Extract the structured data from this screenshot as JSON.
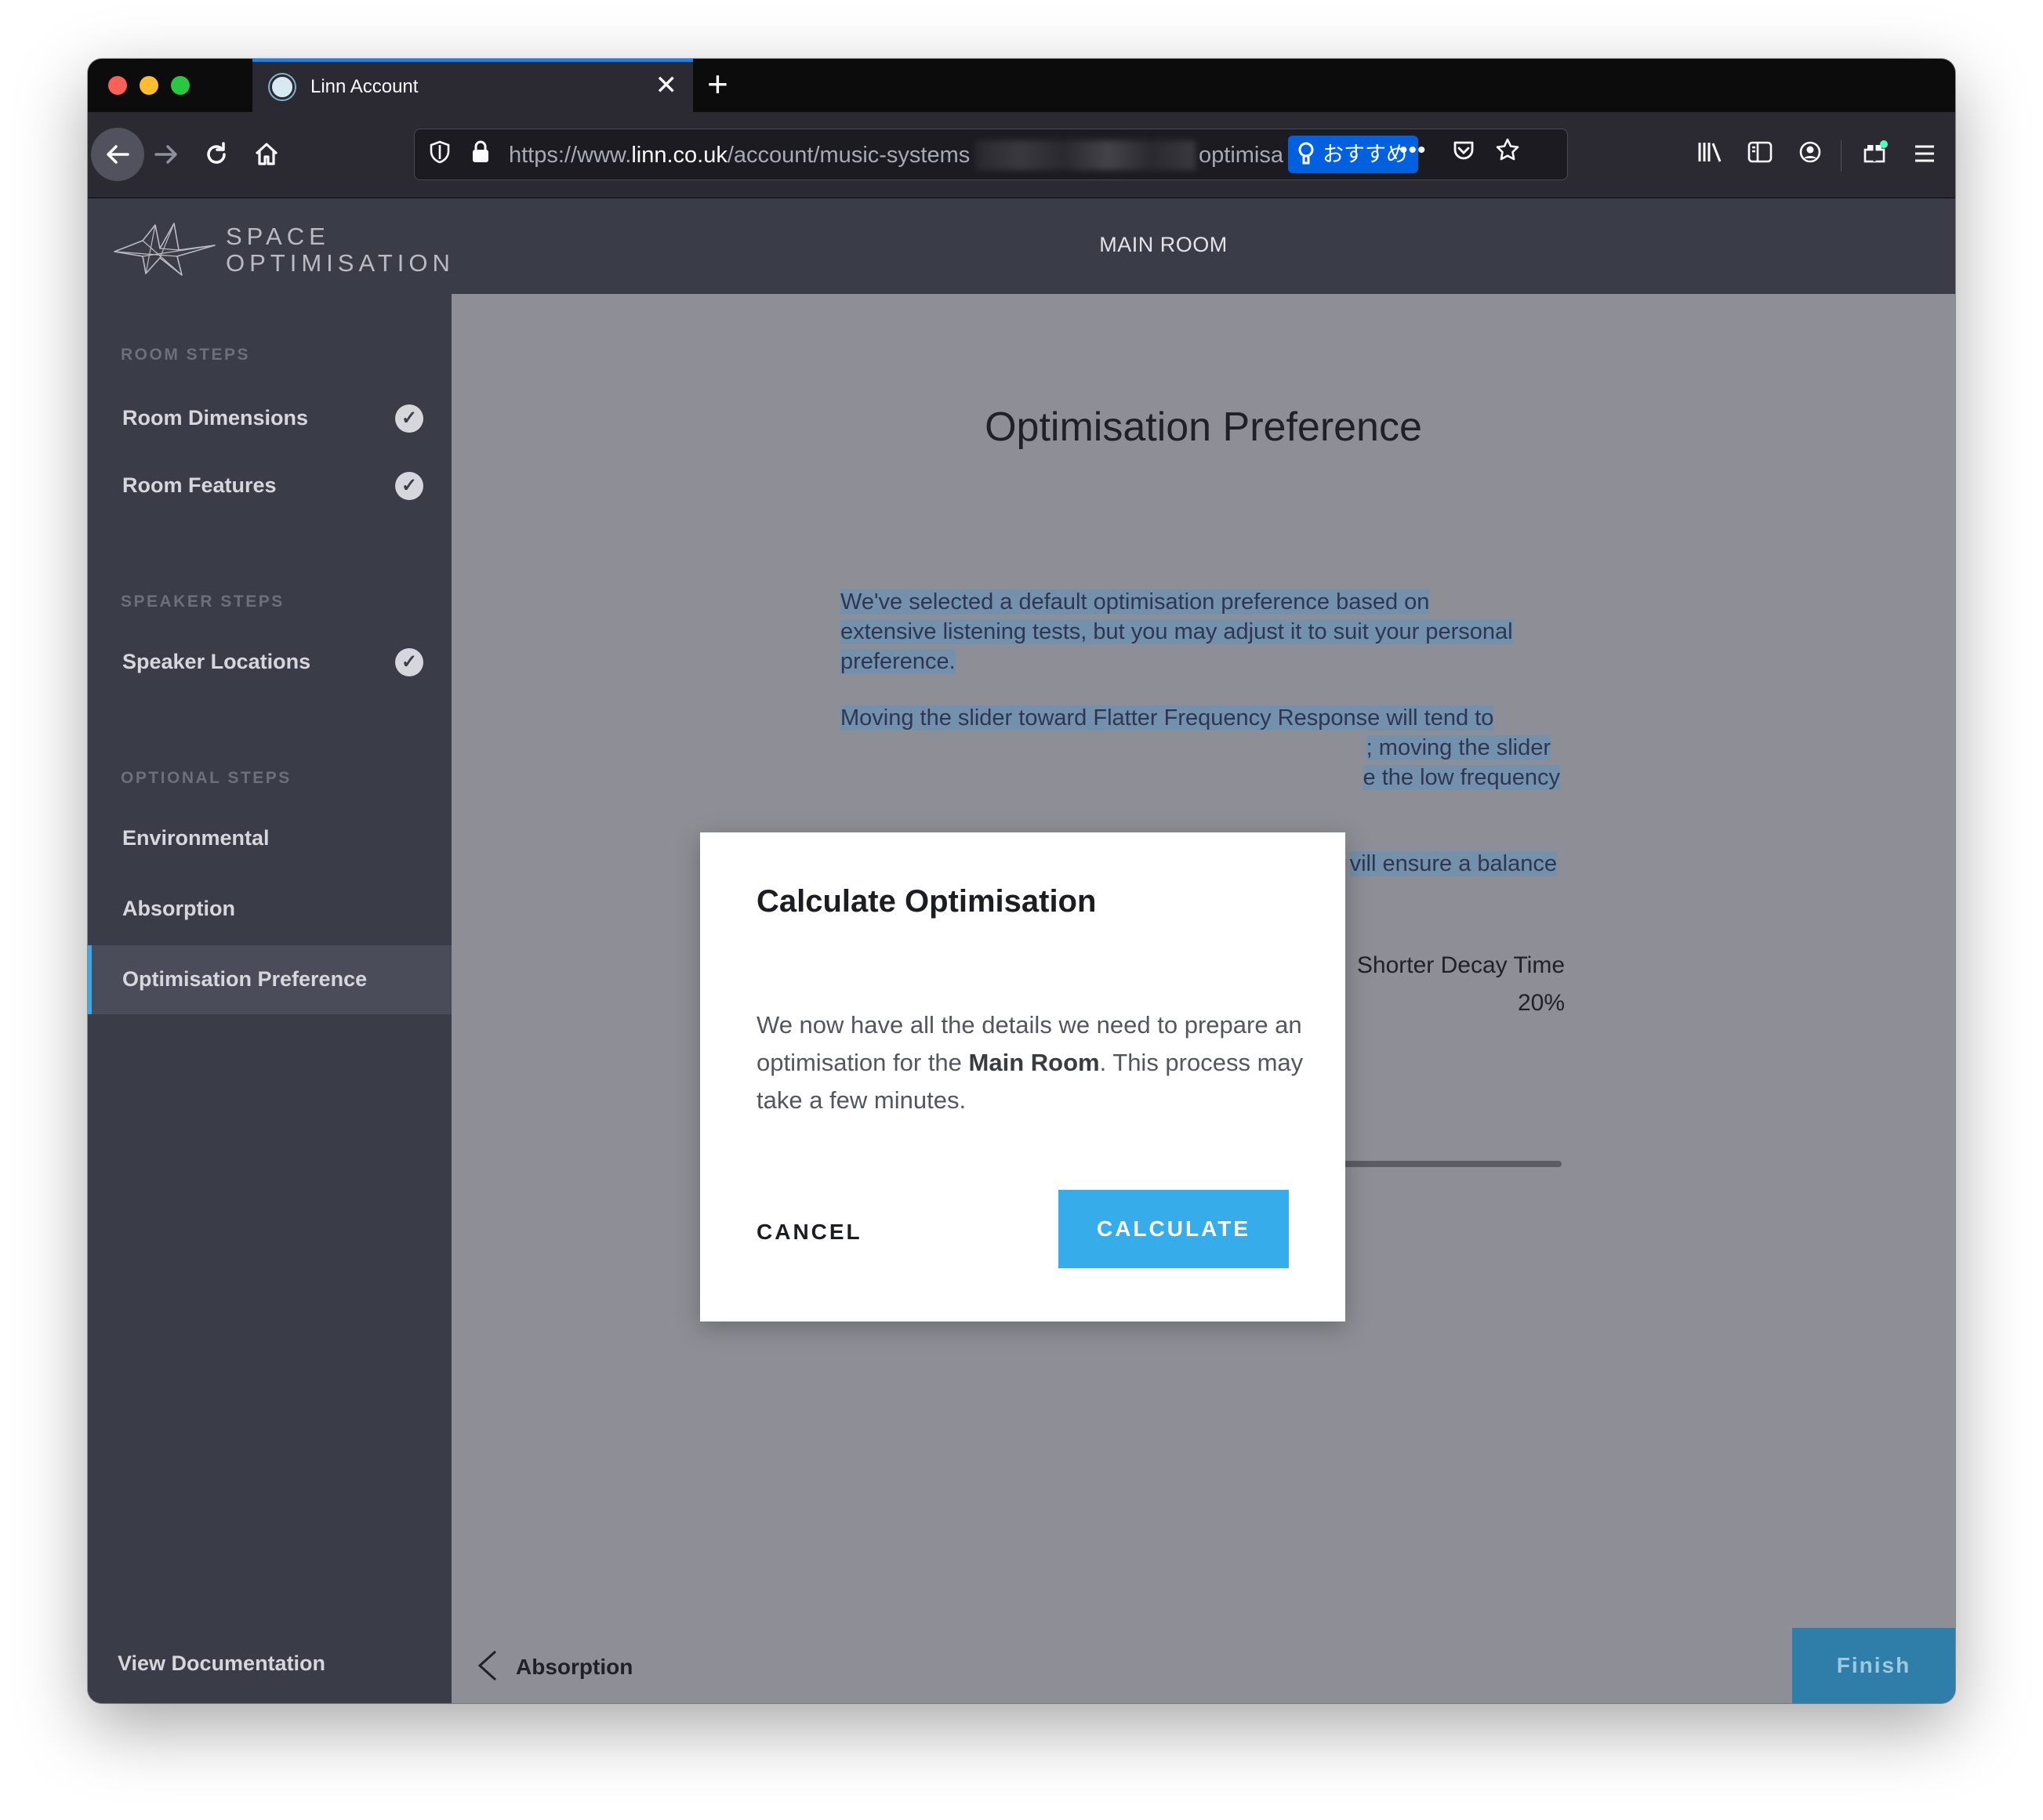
{
  "browser": {
    "tab_title": "Linn Account",
    "tab_close": "✕",
    "new_tab": "+",
    "url_prefix": "https://www.",
    "url_domain": "linn.co.uk",
    "url_path": "/account/music-systems",
    "url_tail": "optimisa",
    "recommend_label": "おすすめ",
    "icons": {
      "back": "back-arrow-icon",
      "forward": "forward-arrow-icon",
      "reload": "reload-icon",
      "home": "home-icon",
      "shield": "shield-icon",
      "lock": "lock-icon",
      "lightbulb": "lightbulb-icon",
      "more": "more-icon",
      "pocket": "pocket-icon",
      "star": "star-icon",
      "library": "library-icon",
      "sidebar": "sidebar-icon",
      "account": "account-icon",
      "extensions": "extensions-icon",
      "menu": "menu-icon"
    }
  },
  "app": {
    "logo_line1": "SPACE",
    "logo_line2": "OPTIMISATION",
    "room_name": "MAIN ROOM",
    "sidebar": {
      "room_steps_title": "ROOM STEPS",
      "speaker_steps_title": "SPEAKER STEPS",
      "optional_steps_title": "OPTIONAL STEPS",
      "steps": [
        {
          "label": "Room Dimensions",
          "completed": true
        },
        {
          "label": "Room Features",
          "completed": true
        },
        {
          "label": "Speaker Locations",
          "completed": true
        },
        {
          "label": "Environmental",
          "completed": false
        },
        {
          "label": "Absorption",
          "completed": false
        },
        {
          "label": "Optimisation Preference",
          "completed": false,
          "active": true
        }
      ],
      "view_documentation": "View Documentation"
    },
    "main": {
      "title": "Optimisation Preference",
      "para1_lines": [
        "We've selected a default optimisation preference based on",
        "extensive listening tests, but you may adjust it to suit your personal",
        "preference."
      ],
      "para2_line1": "Moving the slider toward Flatter Frequency Response will tend to",
      "para2_line2": "; moving the slider",
      "para2_line3": "e the low frequency",
      "para3_fragment": "vill ensure a balance",
      "slider_right_label": "Shorter Decay Time",
      "slider_value": "20%",
      "slider_value_number": 20
    },
    "footer": {
      "back_label": "Absorption",
      "finish_label": "Finish"
    },
    "modal": {
      "title": "Calculate Optimisation",
      "body_before": "We now have all the details we need to prepare an optimisation for the ",
      "body_bold": "Main Room",
      "body_after": ". This process may take a few minutes.",
      "cancel_label": "CANCEL",
      "calculate_label": "CALCULATE"
    },
    "colors": {
      "accent": "#36adea",
      "sidebar_bg": "#3a3c48",
      "selection": "#7390ad"
    }
  }
}
